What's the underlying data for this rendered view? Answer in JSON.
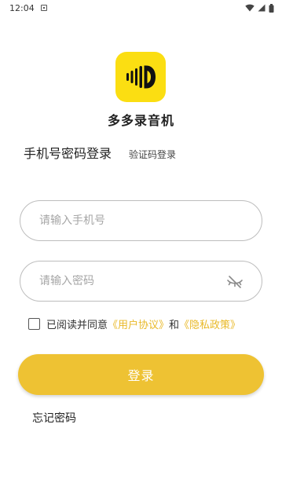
{
  "status_bar": {
    "time": "12:04"
  },
  "app": {
    "name": "多多录音机",
    "logo_icon": "sound-wave-logo-icon",
    "brand_color": "#FBDE12"
  },
  "tabs": {
    "phone_password_login": "手机号密码登录",
    "code_login": "验证码登录"
  },
  "form": {
    "phone_placeholder": "请输入手机号",
    "phone_value": "",
    "password_placeholder": "请输入密码",
    "password_value": "",
    "password_visibility_icon": "eye-off-icon"
  },
  "agreement": {
    "prefix": "已阅读并同意",
    "user_agreement": "《用户协议》",
    "and": "和",
    "privacy_policy": "《隐私政策》",
    "checked": false,
    "link_color": "#E9B928"
  },
  "login_button": {
    "label": "登录",
    "color": "#EEC233"
  },
  "forgot_password": {
    "label": "忘记密码"
  }
}
